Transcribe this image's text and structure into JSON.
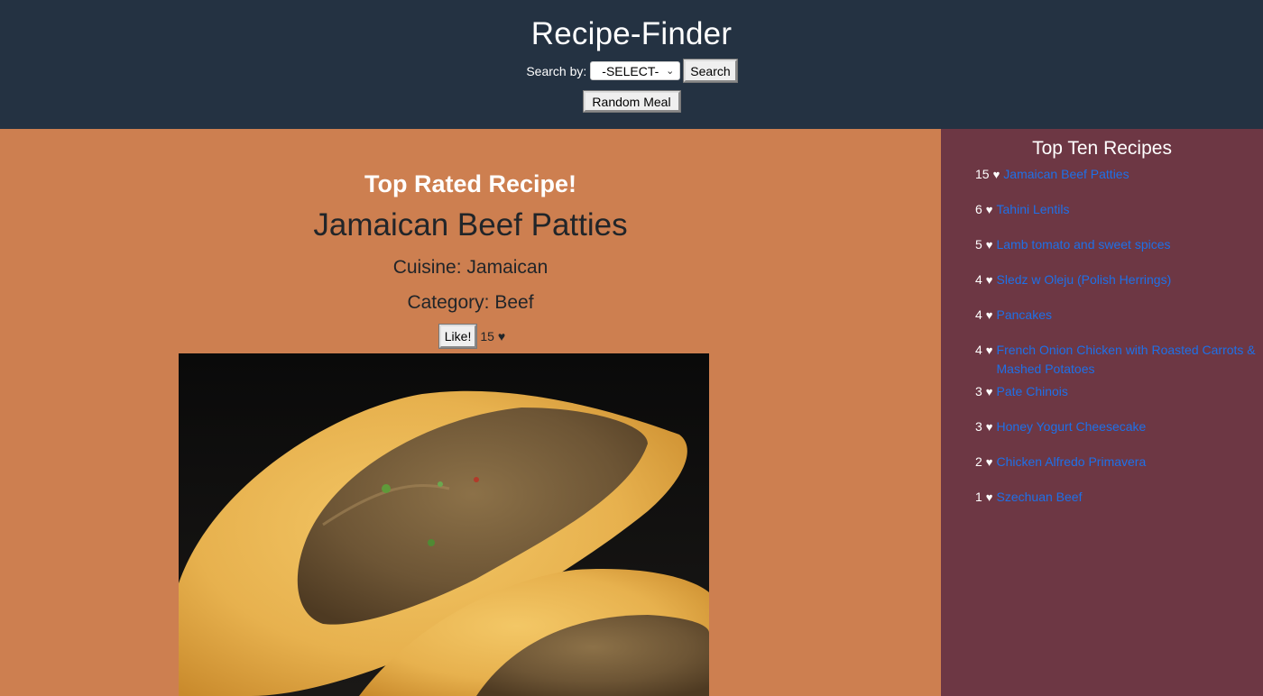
{
  "header": {
    "title": "Recipe-Finder",
    "search_label": "Search by:",
    "select_value": "-SELECT-",
    "search_button": "Search",
    "random_button": "Random Meal"
  },
  "main": {
    "heading": "Top Rated Recipe!",
    "recipe_name": "Jamaican Beef Patties",
    "cuisine": "Cuisine: Jamaican",
    "category": "Category: Beef",
    "like_button": "Like!",
    "likes": "15",
    "heart": "♥",
    "image_alt": "Jamaican Beef Patties photo"
  },
  "sidebar": {
    "title": "Top Ten Recipes",
    "heart": "♥",
    "items": [
      {
        "count": "15",
        "name": "Jamaican Beef Patties"
      },
      {
        "count": "6",
        "name": "Tahini Lentils"
      },
      {
        "count": "5",
        "name": "Lamb tomato and sweet spices"
      },
      {
        "count": "4",
        "name": "Sledz w Oleju (Polish Herrings)"
      },
      {
        "count": "4",
        "name": "Pancakes"
      },
      {
        "count": "4",
        "name": "French Onion Chicken with Roasted Carrots & Mashed Potatoes"
      },
      {
        "count": "3",
        "name": "Pate Chinois"
      },
      {
        "count": "3",
        "name": "Honey Yogurt Cheesecake"
      },
      {
        "count": "2",
        "name": "Chicken Alfredo Primavera"
      },
      {
        "count": "1",
        "name": "Szechuan Beef"
      }
    ]
  },
  "colors": {
    "header_bg": "#243242",
    "main_bg": "#cd7f50",
    "sidebar_bg": "#6d3744",
    "link": "#1e70e8"
  }
}
